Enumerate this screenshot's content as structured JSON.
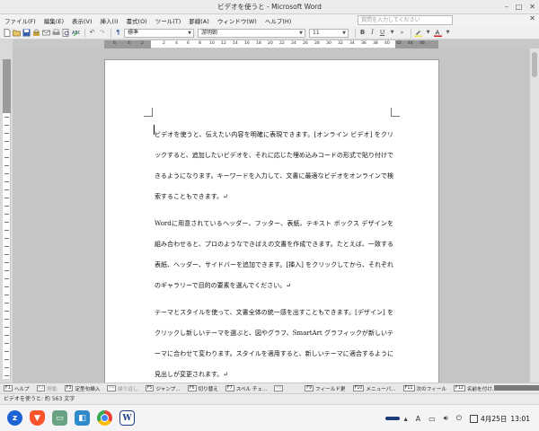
{
  "window": {
    "title": "ビデオを使うと - Microsoft Word",
    "controls": [
      "–",
      "□",
      "✕"
    ]
  },
  "menu": {
    "items": [
      "ファイル(F)",
      "編集(E)",
      "表示(V)",
      "挿入(I)",
      "書式(O)",
      "ツール(T)",
      "罫線(A)",
      "ウィンドウ(W)",
      "ヘルプ(H)"
    ],
    "help_placeholder": "質問を入力してください",
    "close": "✕"
  },
  "toolbar": {
    "icons": [
      "new-icon",
      "open-icon",
      "save-icon",
      "permission-icon",
      "email-icon",
      "print-icon",
      "preview-icon",
      "spelling-icon",
      "undo-icon",
      "redo-icon"
    ],
    "undo": "↶",
    "redo": "↷",
    "style_label": "標準",
    "font_label": "游明朝",
    "size_label": "11",
    "bold": "B",
    "italic": "I",
    "underline": "U",
    "highlight_color": "#f5e14a",
    "font_color": "#d92020"
  },
  "ruler": {
    "h_left": [
      "6",
      "4",
      "2"
    ],
    "h_right": [
      "2",
      "4",
      "6",
      "8",
      "10",
      "12",
      "14",
      "16",
      "18",
      "20",
      "22",
      "24",
      "26",
      "28",
      "30",
      "32",
      "34",
      "36",
      "38",
      "40",
      "42",
      "44",
      "46"
    ]
  },
  "document": {
    "paragraphs": [
      "ビデオを使うと、伝えたい内容を明確に表現できます。[オンライン ビデオ] をクリックすると、追加したいビデオを、それに応じた埋め込みコードの形式で貼り付けできるようになります。キーワードを入力して、文書に最適なビデオをオンラインで検索することもできます。↵",
      "Wordに用意されているヘッダー、フッター、表紙、テキスト ボックス デザインを組み合わせると、プロのようなできばえの文書を作成できます。たとえば、一致する表紙、ヘッダー、サイドバーを追加できます。[挿入] をクリックしてから、それぞれのギャラリーで目的の要素を選んでください。↵",
      "テーマとスタイルを使って、文書全体の統一感を出すこともできます。[デザイン] をクリックし新しいテーマを選ぶと、図やグラフ、SmartArt グラフィックが新しいテーマに合わせて変わります。スタイルを適用すると、新しいテーマに適合するように見出しが変更されます。↵"
    ]
  },
  "fkeys": [
    {
      "key": "F1",
      "label": "ヘルプ",
      "enabled": true
    },
    {
      "key": "F2",
      "label": "移動",
      "enabled": false
    },
    {
      "key": "F3",
      "label": "定型句挿入",
      "enabled": true
    },
    {
      "key": "F4",
      "label": "繰り返し",
      "enabled": false
    },
    {
      "key": "F5",
      "label": "ジャンプ...",
      "enabled": true
    },
    {
      "key": "F6",
      "label": "切り替え",
      "enabled": true
    },
    {
      "key": "F7",
      "label": "スペル チェ...",
      "enabled": true
    },
    {
      "key": "F8",
      "label": "",
      "enabled": false
    },
    {
      "key": "F9",
      "label": "フィールド更",
      "enabled": true
    },
    {
      "key": "F10",
      "label": "メニューバ...",
      "enabled": true
    },
    {
      "key": "F11",
      "label": "次のフィール",
      "enabled": true
    },
    {
      "key": "F12",
      "label": "名前を付け...",
      "enabled": true
    }
  ],
  "status": {
    "text": "ビデオを使うと: 約 563 文字"
  },
  "taskbar": {
    "apps": [
      "start-icon",
      "brave-icon",
      "files-icon",
      "store-icon",
      "chrome-icon",
      "word-icon"
    ],
    "word_glyph": "W",
    "tray_a": "A",
    "date": "4月25日",
    "time": "13:01"
  }
}
